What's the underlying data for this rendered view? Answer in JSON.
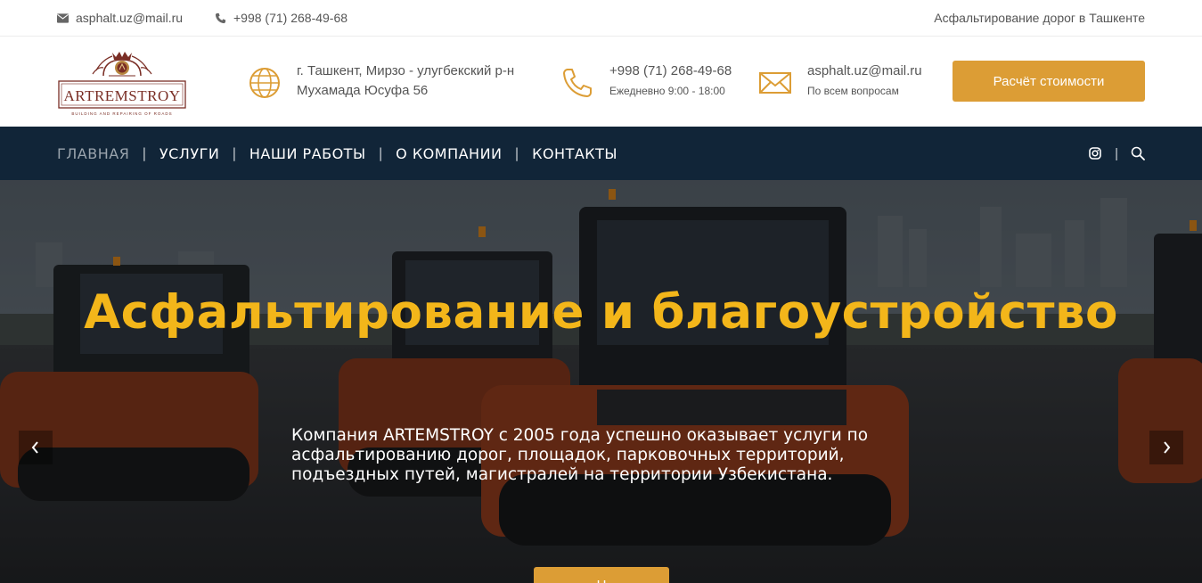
{
  "topbar": {
    "email": "asphalt.uz@mail.ru",
    "phone": "+998 (71) 268-49-68",
    "slogan": "Асфальтирование дорог в Ташкенте"
  },
  "header": {
    "logo": {
      "text": "ARTREMSTROY",
      "tagline": "BUILDING AND REPAIRING OF ROADS"
    },
    "address": {
      "line1": "г. Ташкент, Мирзо - улугбекский р-н",
      "line2": "Мухамада Юсуфа 56"
    },
    "phone": {
      "number": "+998 (71) 268-49-68",
      "hours": "Ежедневно 9:00 - 18:00"
    },
    "mail": {
      "email": "asphalt.uz@mail.ru",
      "note": "По всем вопросам"
    },
    "cta_label": "Расчёт стоимости"
  },
  "nav": {
    "items": [
      {
        "label": "ГЛАВНАЯ",
        "active": true
      },
      {
        "label": "УСЛУГИ",
        "active": false
      },
      {
        "label": "НАШИ РАБОТЫ",
        "active": false
      },
      {
        "label": "О КОМПАНИИ",
        "active": false
      },
      {
        "label": "КОНТАКТЫ",
        "active": false
      }
    ],
    "icons": [
      "instagram-icon",
      "search-icon"
    ]
  },
  "hero": {
    "title": "Асфальтирование и благоустройство",
    "text": "Компания ARTEMSTROY с 2005 года успешно оказывает услуги по асфальтированию дорог, площадок, парковочных территорий, подъездных путей, магистралей на территории Узбекистана.",
    "button_label": "Н"
  },
  "colors": {
    "accent": "#dc9d35",
    "nav_bg": "#112538",
    "hero_title": "#f3b61a",
    "logo_brown": "#7a2e25"
  }
}
